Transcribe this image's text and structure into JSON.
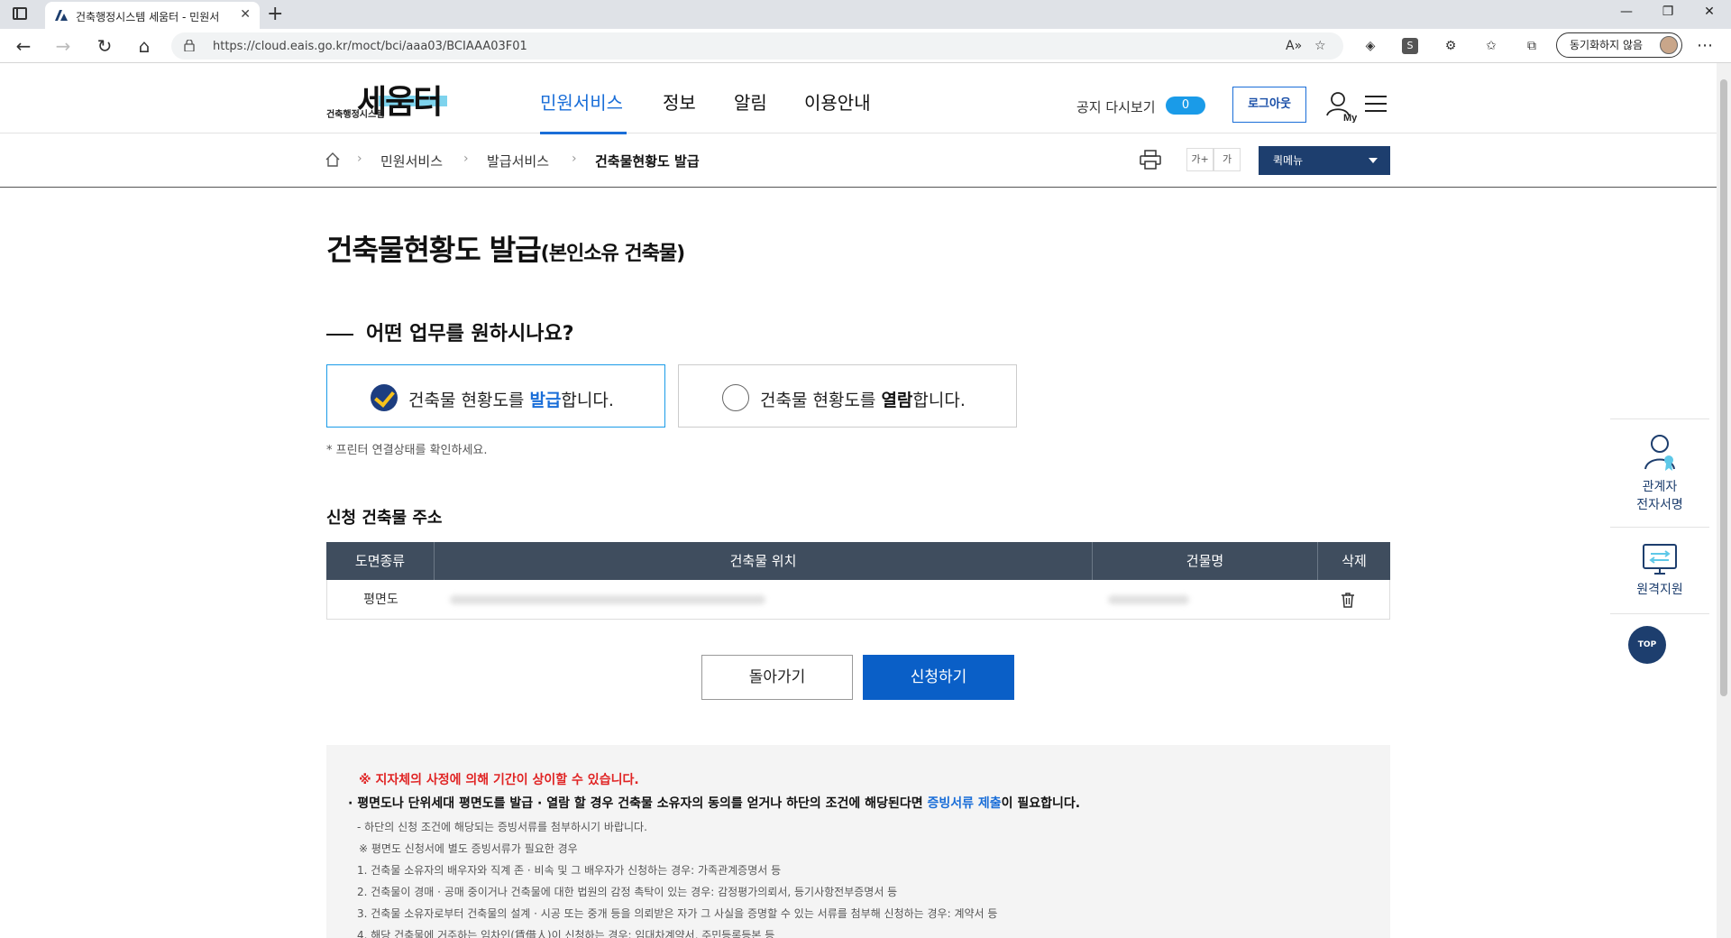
{
  "browser": {
    "tab_title": "건축행정시스템 세움터 - 민원서",
    "url": "https://cloud.eais.go.kr/moct/bci/aaa03/BCIAAA03F01",
    "sync_label": "동기화하지 않음"
  },
  "header": {
    "logo_sub": "건축행정시스템",
    "logo_main": "세움터",
    "nav": [
      "민원서비스",
      "정보",
      "알림",
      "이용안내"
    ],
    "notice_label": "공지 다시보기",
    "notice_count": "0",
    "logout_label": "로그아웃"
  },
  "breadcrumb": {
    "items": [
      "민원서비스",
      "발급서비스",
      "건축물현황도 발급"
    ],
    "font_larger": "가+",
    "font_smaller": "가",
    "quick_menu": "퀵메뉴"
  },
  "page": {
    "title": "건축물현황도 발급",
    "title_sub": "(본인소유 건축물)",
    "question": "어떤 업무를 원하시나요?",
    "option_issue": {
      "pre": "건축물 현황도를 ",
      "hl": "발급",
      "post": "합니다."
    },
    "option_view": {
      "pre": "건축물 현황도를 ",
      "hl": "열람",
      "post": "합니다."
    },
    "note": "* 프린터 연결상태를 확인하세요.",
    "address_title": "신청 건축물 주소"
  },
  "table": {
    "headers": [
      "도면종류",
      "건축물 위치",
      "건물명",
      "삭제"
    ],
    "rows": [
      {
        "type": "평면도"
      }
    ]
  },
  "buttons": {
    "back": "돌아가기",
    "apply": "신청하기"
  },
  "info": {
    "warn": "※ 지자체의 사정에 의해 기간이 상이할 수 있습니다.",
    "main_pre": "· 평면도나 단위세대 평면도를 발급 · 열람 할 경우 건축물 소유자의 동의를 얻거나 하단의 조건에 해당된다면 ",
    "main_link": "증빙서류 제출",
    "main_post": "이 필요합니다.",
    "lines": [
      "- 하단의 신청 조건에 해당되는 증빙서류를 첨부하시기 바랍니다.",
      "※ 평면도 신청서에 별도 증빙서류가 필요한 경우",
      "1. 건축물 소유자의 배우자와 직계 존 · 비속 및 그 배우자가 신청하는 경우: 가족관계증명서 등",
      "2. 건축물이 경매 · 공매 중이거나 건축물에 대한 법원의 감정 촉탁이 있는 경우: 감정평가의뢰서, 등기사항전부증명서 등",
      "3. 건축물 소유자로부터 건축물의 설계 · 시공 또는 중개 등을 의뢰받은 자가 그 사실을 증명할 수 있는 서류를 첨부해 신청하는 경우: 계약서 등",
      "4. 해당 건축물에 거주하는 임차인(賃借人)이 신청하는 경우: 임대차계약서, 주민등록등본 등"
    ]
  },
  "side": {
    "sign_label_1": "관계자",
    "sign_label_2": "전자서명",
    "remote_label": "원격지원",
    "top_label": "TOP"
  },
  "icons": [
    "sidebar-toggle-icon",
    "back-icon",
    "forward-icon",
    "refresh-icon",
    "home-icon",
    "lock-icon",
    "read-aloud-icon",
    "favorite-add-icon",
    "extension-icon",
    "favorites-icon",
    "collections-icon",
    "print-icon",
    "trash-icon",
    "person-badge-icon",
    "monitor-icon",
    "my-user-icon",
    "menu-icon"
  ],
  "colors": {
    "primary": "#1a6ed8",
    "navy": "#1d3e6e",
    "table_head": "#3f4d5e",
    "warning": "#e02424",
    "apply_button": "#0a5fc7"
  }
}
